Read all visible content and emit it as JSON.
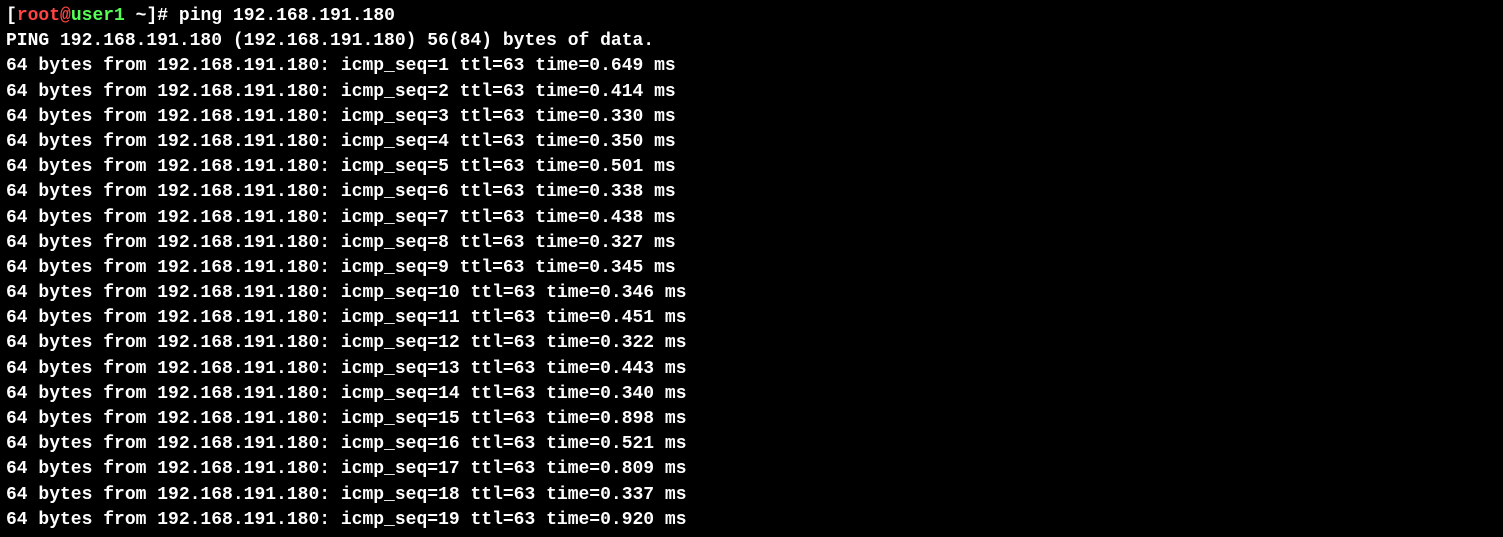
{
  "prompt": {
    "open_bracket": "[",
    "user": "root",
    "at": "@",
    "host": "user1",
    "space": " ",
    "tilde": "~",
    "close_bracket": "]",
    "hash": "# "
  },
  "command": "ping 192.168.191.180",
  "ping_header": "PING 192.168.191.180 (192.168.191.180) 56(84) bytes of data.",
  "ping_source": "192.168.191.180",
  "ttl": 63,
  "replies": [
    {
      "seq": 1,
      "time": "0.649"
    },
    {
      "seq": 2,
      "time": "0.414"
    },
    {
      "seq": 3,
      "time": "0.330"
    },
    {
      "seq": 4,
      "time": "0.350"
    },
    {
      "seq": 5,
      "time": "0.501"
    },
    {
      "seq": 6,
      "time": "0.338"
    },
    {
      "seq": 7,
      "time": "0.438"
    },
    {
      "seq": 8,
      "time": "0.327"
    },
    {
      "seq": 9,
      "time": "0.345"
    },
    {
      "seq": 10,
      "time": "0.346"
    },
    {
      "seq": 11,
      "time": "0.451"
    },
    {
      "seq": 12,
      "time": "0.322"
    },
    {
      "seq": 13,
      "time": "0.443"
    },
    {
      "seq": 14,
      "time": "0.340"
    },
    {
      "seq": 15,
      "time": "0.898"
    },
    {
      "seq": 16,
      "time": "0.521"
    },
    {
      "seq": 17,
      "time": "0.809"
    },
    {
      "seq": 18,
      "time": "0.337"
    },
    {
      "seq": 19,
      "time": "0.920"
    }
  ]
}
